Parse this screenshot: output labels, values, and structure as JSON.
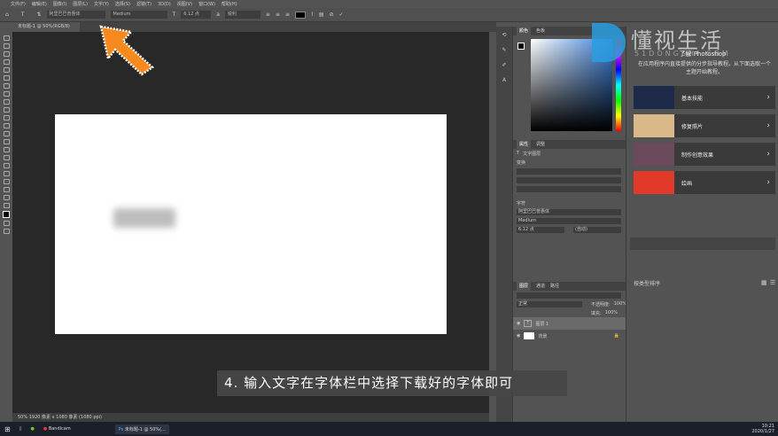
{
  "menu": [
    "文件(F)",
    "编辑(E)",
    "图像(I)",
    "图层(L)",
    "文字(Y)",
    "选择(S)",
    "滤镜(T)",
    "3D(D)",
    "视图(V)",
    "窗口(W)",
    "帮助(H)"
  ],
  "options": {
    "font_family": "阿里巴巴普惠体",
    "font_style": "Medium",
    "font_size": "6.12 点",
    "antialias": "锐利"
  },
  "doc_tab": "未标题-1 @ 50%(RGB/8)",
  "status": "50%   1920 像素 x 1080 像素 (1080 ppi)",
  "panels": {
    "color_tabs": [
      "颜色",
      "色板"
    ],
    "props_tabs": [
      "属性",
      "调整"
    ],
    "text_layer": "文字图层",
    "transform": "变换",
    "char": "字符",
    "char_font": "阿里巴巴普惠体",
    "char_style": "Medium",
    "char_size": "6.12 点",
    "char_leading": "(自动)",
    "layers_tabs": [
      "图层",
      "通道",
      "路径"
    ],
    "blend": "正常",
    "opacity_label": "不透明度:",
    "opacity": "100%",
    "fill_label": "填充:",
    "fill": "100%",
    "layers": [
      {
        "name": "图层 1",
        "type": "text"
      },
      {
        "name": "背景",
        "type": "bg"
      }
    ]
  },
  "learn": {
    "title": "了解 Photoshop",
    "desc": "在应用程序内直接提供的分步指导教程。从下面选取一个主题开始教程。",
    "items": [
      "基本技能",
      "修复照片",
      "制作创意效果",
      "绘画"
    ],
    "sort": "按类型排序"
  },
  "watermark": {
    "name": "懂视生活",
    "url": "51DONGSHI.COM"
  },
  "subtitle": "4. 输入文字在字体栏中选择下载好的字体即可",
  "taskbar": {
    "apps": [
      "Bandicam",
      "未标题-1 @ 50%(..."
    ],
    "time": "10:21",
    "date": "2020/1/27"
  },
  "colors": {
    "arrow": "#f7891f",
    "accent": "#3a7ed9"
  }
}
